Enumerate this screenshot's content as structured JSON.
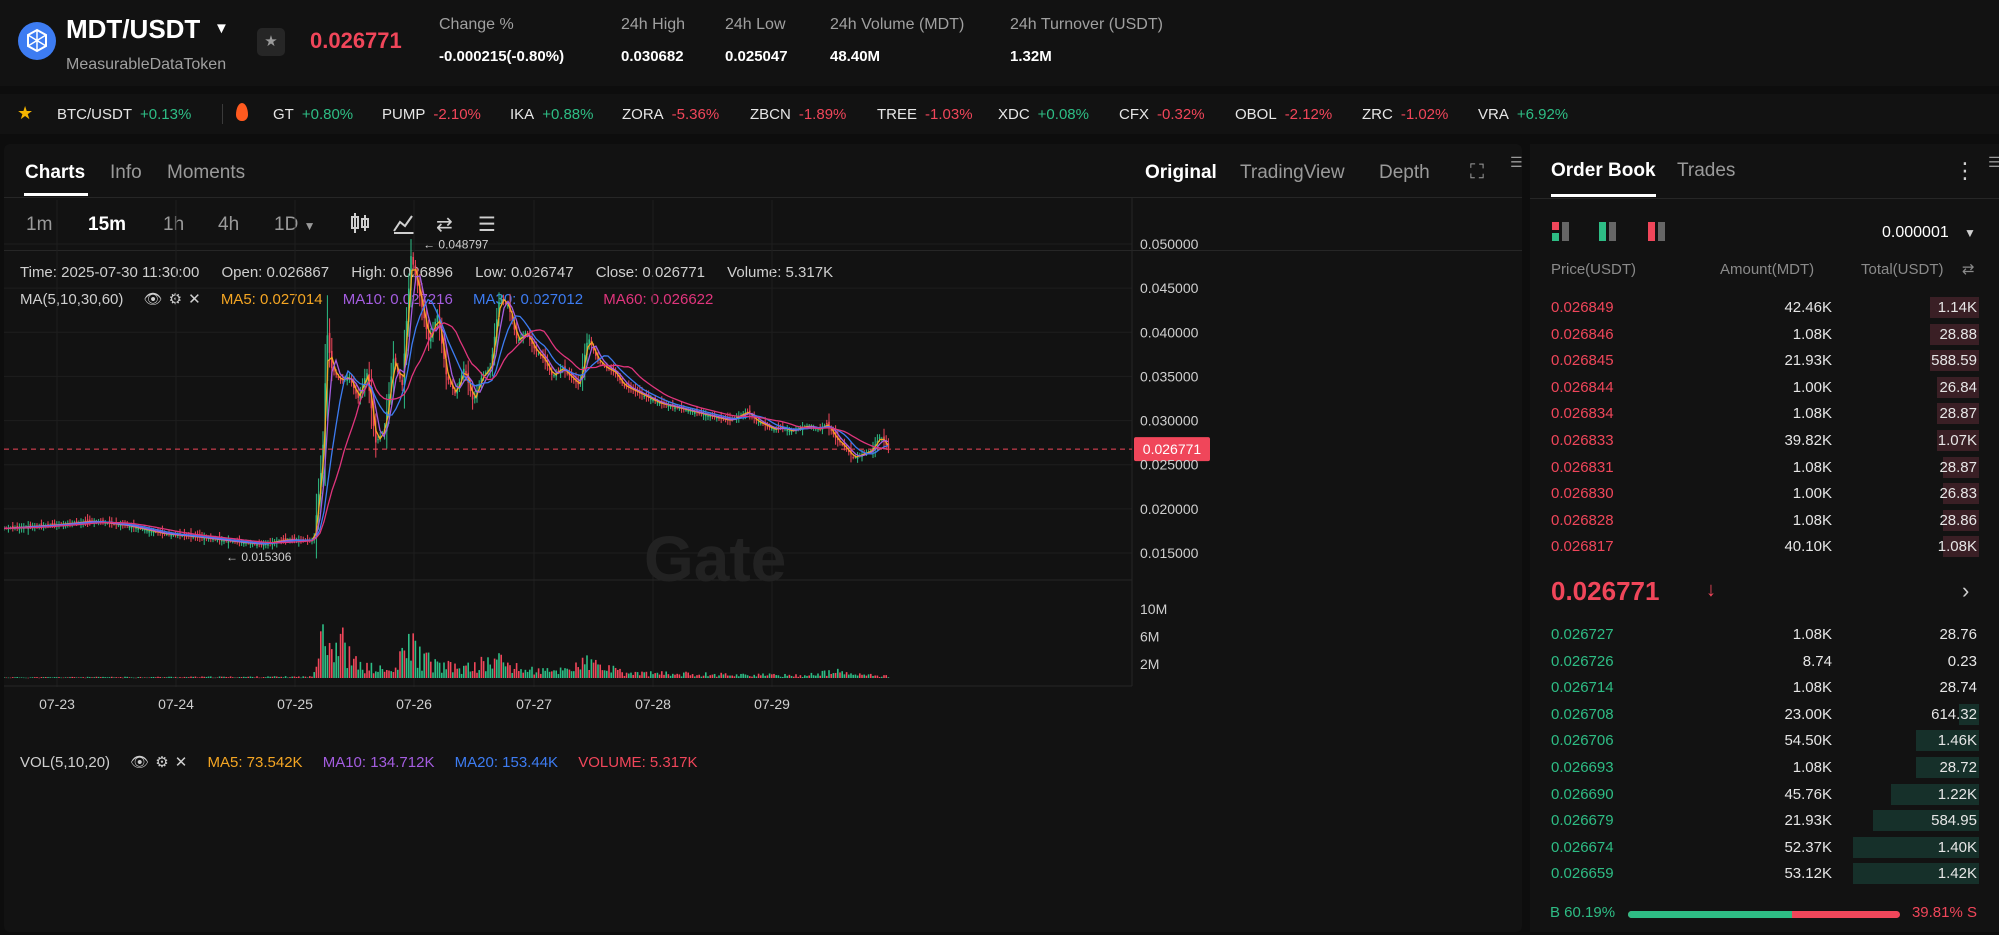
{
  "pair": {
    "symbol": "MDT/USDT",
    "name": "MeasurableDataToken",
    "last_price": "0.026771",
    "change_label": "Change %",
    "change_value": "-0.000215(-0.80%)",
    "high_label": "24h High",
    "high_value": "0.030682",
    "low_label": "24h Low",
    "low_value": "0.025047",
    "volume_label": "24h Volume (MDT)",
    "volume_value": "48.40M",
    "turnover_label": "24h Turnover (USDT)",
    "turnover_value": "1.32M"
  },
  "ticker": [
    {
      "symbol": "BTC/USDT",
      "change": "+0.13%"
    },
    {
      "symbol": "GT",
      "change": "+0.80%"
    },
    {
      "symbol": "PUMP",
      "change": "-2.10%"
    },
    {
      "symbol": "IKA",
      "change": "+0.88%"
    },
    {
      "symbol": "ZORA",
      "change": "-5.36%"
    },
    {
      "symbol": "ZBCN",
      "change": "-1.89%"
    },
    {
      "symbol": "TREE",
      "change": "-1.03%"
    },
    {
      "symbol": "XDC",
      "change": "+0.08%"
    },
    {
      "symbol": "CFX",
      "change": "-0.32%"
    },
    {
      "symbol": "OBOL",
      "change": "-2.12%"
    },
    {
      "symbol": "ZRC",
      "change": "-1.02%"
    },
    {
      "symbol": "VRA",
      "change": "+6.92%"
    }
  ],
  "chart_panel": {
    "tabs": [
      "Charts",
      "Info",
      "Moments"
    ],
    "views": [
      "Original",
      "TradingView",
      "Depth"
    ],
    "intervals": [
      "1m",
      "15m",
      "1h",
      "4h",
      "1D"
    ],
    "watermark": "Gate"
  },
  "kline_info": {
    "time": "Time: 2025-07-30 11:30:00",
    "open": "Open: 0.026867",
    "high": "High: 0.026896",
    "low": "Low: 0.026747",
    "close": "Close: 0.026771",
    "volume": "Volume: 5.317K"
  },
  "ma_legend": {
    "label": "MA(5,10,30,60)",
    "ma5": "MA5: 0.027014",
    "ma10": "MA10: 0.027216",
    "ma30": "MA30: 0.027012",
    "ma60": "MA60: 0.026622"
  },
  "vol_legend": {
    "label": "VOL(5,10,20)",
    "ma5": "MA5: 73.542K",
    "ma10": "MA10: 134.712K",
    "ma20": "MA20: 153.44K",
    "volume": "VOLUME: 5.317K"
  },
  "colors": {
    "up": "#2ebd85",
    "down": "#f0465a",
    "ma5": "#f5a623",
    "ma10": "#a45de0",
    "ma30": "#3d7cf2",
    "ma60": "#e0357d"
  },
  "chart_data": {
    "type": "candlestick",
    "price_axis": [
      "0.050000",
      "0.045000",
      "0.040000",
      "0.035000",
      "0.030000",
      "0.025000",
      "0.020000",
      "0.015000"
    ],
    "price_ticks": [
      0.05,
      0.045,
      0.04,
      0.035,
      0.03,
      0.025,
      0.02,
      0.015
    ],
    "volume_axis": [
      "10M",
      "6M",
      "2M"
    ],
    "volume_ticks": [
      10,
      6,
      2
    ],
    "x_axis": [
      "07-23",
      "07-24",
      "07-25",
      "07-26",
      "07-27",
      "07-28",
      "07-29"
    ],
    "max_label": "0.048797",
    "min_label": "0.015306",
    "current_price": "0.026771",
    "close_path": [
      [
        0,
        0.0178
      ],
      [
        0.06,
        0.0182
      ],
      [
        0.1,
        0.0186
      ],
      [
        0.14,
        0.0181
      ],
      [
        0.18,
        0.0172
      ],
      [
        0.22,
        0.0168
      ],
      [
        0.26,
        0.0163
      ],
      [
        0.29,
        0.016
      ],
      [
        0.32,
        0.0165
      ],
      [
        0.35,
        0.0164
      ],
      [
        0.36,
        0.026
      ],
      [
        0.365,
        0.04
      ],
      [
        0.37,
        0.036
      ],
      [
        0.38,
        0.0345
      ],
      [
        0.39,
        0.035
      ],
      [
        0.4,
        0.0325
      ],
      [
        0.41,
        0.0355
      ],
      [
        0.42,
        0.0275
      ],
      [
        0.43,
        0.029
      ],
      [
        0.44,
        0.037
      ],
      [
        0.45,
        0.034
      ],
      [
        0.46,
        0.0488
      ],
      [
        0.47,
        0.044
      ],
      [
        0.48,
        0.039
      ],
      [
        0.49,
        0.042
      ],
      [
        0.5,
        0.035
      ],
      [
        0.51,
        0.033
      ],
      [
        0.52,
        0.036
      ],
      [
        0.53,
        0.0322
      ],
      [
        0.54,
        0.035
      ],
      [
        0.55,
        0.036
      ],
      [
        0.56,
        0.044
      ],
      [
        0.57,
        0.043
      ],
      [
        0.58,
        0.039
      ],
      [
        0.59,
        0.04
      ],
      [
        0.6,
        0.038
      ],
      [
        0.61,
        0.037
      ],
      [
        0.62,
        0.035
      ],
      [
        0.63,
        0.036
      ],
      [
        0.64,
        0.035
      ],
      [
        0.65,
        0.034
      ],
      [
        0.66,
        0.0395
      ],
      [
        0.67,
        0.037
      ],
      [
        0.68,
        0.036
      ],
      [
        0.69,
        0.0355
      ],
      [
        0.7,
        0.034
      ],
      [
        0.72,
        0.033
      ],
      [
        0.74,
        0.032
      ],
      [
        0.76,
        0.0315
      ],
      [
        0.78,
        0.031
      ],
      [
        0.8,
        0.0305
      ],
      [
        0.82,
        0.03
      ],
      [
        0.84,
        0.031
      ],
      [
        0.85,
        0.03
      ],
      [
        0.86,
        0.0295
      ],
      [
        0.87,
        0.029
      ],
      [
        0.88,
        0.0292
      ],
      [
        0.89,
        0.0288
      ],
      [
        0.9,
        0.0292
      ],
      [
        0.91,
        0.0294
      ],
      [
        0.92,
        0.029
      ],
      [
        0.93,
        0.0296
      ],
      [
        0.94,
        0.028
      ],
      [
        0.95,
        0.027
      ],
      [
        0.96,
        0.0258
      ],
      [
        0.97,
        0.0262
      ],
      [
        0.98,
        0.0266
      ],
      [
        0.99,
        0.0282
      ],
      [
        1.0,
        0.0268
      ]
    ],
    "volume_path": [
      [
        0,
        0.1
      ],
      [
        0.2,
        0.15
      ],
      [
        0.35,
        0.2
      ],
      [
        0.355,
        8.5
      ],
      [
        0.36,
        10.5
      ],
      [
        0.37,
        5.0
      ],
      [
        0.38,
        6.5
      ],
      [
        0.39,
        3.5
      ],
      [
        0.4,
        2.0
      ],
      [
        0.42,
        1.5
      ],
      [
        0.44,
        1.0
      ],
      [
        0.46,
        6.0
      ],
      [
        0.47,
        3.5
      ],
      [
        0.49,
        2.0
      ],
      [
        0.52,
        1.5
      ],
      [
        0.56,
        3.0
      ],
      [
        0.58,
        1.5
      ],
      [
        0.62,
        1.0
      ],
      [
        0.66,
        2.5
      ],
      [
        0.7,
        0.8
      ],
      [
        0.8,
        0.6
      ],
      [
        0.9,
        0.4
      ],
      [
        0.94,
        1.0
      ],
      [
        0.96,
        0.6
      ],
      [
        1.0,
        0.3
      ]
    ]
  },
  "order_book": {
    "tabs": [
      "Order Book",
      "Trades"
    ],
    "precision": "0.000001",
    "headers": [
      "Price(USDT)",
      "Amount(MDT)",
      "Total(USDT)"
    ],
    "asks": [
      {
        "price": "0.026849",
        "amount": "42.46K",
        "total": "1.14K",
        "depth": 0.35
      },
      {
        "price": "0.026846",
        "amount": "1.08K",
        "total": "28.88",
        "depth": 0.35
      },
      {
        "price": "0.026845",
        "amount": "21.93K",
        "total": "588.59",
        "depth": 0.35
      },
      {
        "price": "0.026844",
        "amount": "1.00K",
        "total": "26.84",
        "depth": 0.3
      },
      {
        "price": "0.026834",
        "amount": "1.08K",
        "total": "28.87",
        "depth": 0.3
      },
      {
        "price": "0.026833",
        "amount": "39.82K",
        "total": "1.07K",
        "depth": 0.3
      },
      {
        "price": "0.026831",
        "amount": "1.08K",
        "total": "28.87",
        "depth": 0.26
      },
      {
        "price": "0.026830",
        "amount": "1.00K",
        "total": "26.83",
        "depth": 0.26
      },
      {
        "price": "0.026828",
        "amount": "1.08K",
        "total": "28.86",
        "depth": 0.26
      },
      {
        "price": "0.026817",
        "amount": "40.10K",
        "total": "1.08K",
        "depth": 0.26
      }
    ],
    "mid_price": "0.026771",
    "bids": [
      {
        "price": "0.026727",
        "amount": "1.08K",
        "total": "28.76",
        "depth": 0.0
      },
      {
        "price": "0.026726",
        "amount": "8.74",
        "total": "0.23",
        "depth": 0.0
      },
      {
        "price": "0.026714",
        "amount": "1.08K",
        "total": "28.74",
        "depth": 0.0
      },
      {
        "price": "0.026708",
        "amount": "23.00K",
        "total": "614.32",
        "depth": 0.14
      },
      {
        "price": "0.026706",
        "amount": "54.50K",
        "total": "1.46K",
        "depth": 0.45
      },
      {
        "price": "0.026693",
        "amount": "1.08K",
        "total": "28.72",
        "depth": 0.45
      },
      {
        "price": "0.026690",
        "amount": "45.76K",
        "total": "1.22K",
        "depth": 0.63
      },
      {
        "price": "0.026679",
        "amount": "21.93K",
        "total": "584.95",
        "depth": 0.76
      },
      {
        "price": "0.026674",
        "amount": "52.37K",
        "total": "1.40K",
        "depth": 0.9
      },
      {
        "price": "0.026659",
        "amount": "53.12K",
        "total": "1.42K",
        "depth": 0.9
      }
    ],
    "buy_ratio": "B 60.19%",
    "sell_ratio": "39.81% S",
    "buy_fraction": 0.6019
  }
}
